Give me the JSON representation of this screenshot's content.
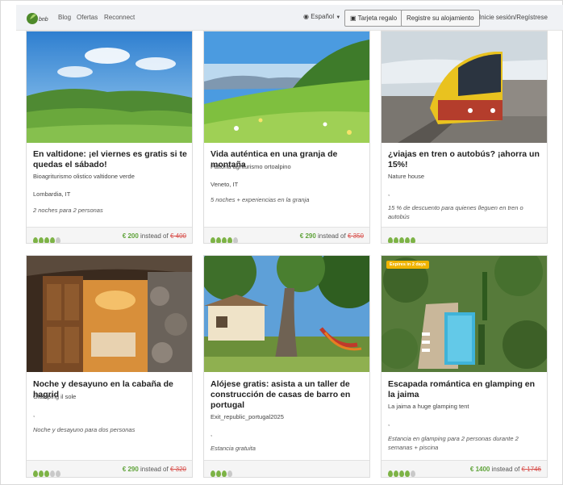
{
  "nav": {
    "logo_text": "bnb",
    "links": [
      "Blog",
      "Ofertas",
      "Reconnect"
    ],
    "language": "Español",
    "gift_card": "Tarjeta regalo",
    "register": "Registre su alojamiento",
    "login": "Inicie sesión/Regístrese"
  },
  "cards": [
    {
      "title": "En valtidone: ¡el viernes es gratis si te quedas el sábado!",
      "host": "Bioagriturismo olistico valtidone verde",
      "location": "Lombardia, IT",
      "offer": "2 noches para 2 personas",
      "rating": 4,
      "price_now": "€ 200",
      "instead_of": "instead of",
      "price_old": "€ 400"
    },
    {
      "title": "Vida auténtica en una granja de montaña",
      "host": "Fattoria agriturismo ortoalpino",
      "location": "Veneto, IT",
      "offer": "5 noches + experiencias en la granja",
      "rating": 4,
      "price_now": "€ 290",
      "instead_of": "instead of",
      "price_old": "€ 350"
    },
    {
      "title": "¿viajas en tren o autobús? ¡ahorra un 15%!",
      "host": "Nature house",
      "location": ",",
      "offer": "15 % de descuento para quienes lleguen en tren o autobús",
      "rating": 5,
      "price_now": "",
      "instead_of": "",
      "price_old": ""
    },
    {
      "title": "Noche y desayuno en la cabaña de hagrid",
      "host": "Glamping il sole",
      "location": ",",
      "offer": "Noche y desayuno para dos personas",
      "rating": 3,
      "price_now": "€ 290",
      "instead_of": "instead of",
      "price_old": "€ 320"
    },
    {
      "title": "Alójese gratis: asista a un taller de construcción de casas de barro en portugal",
      "host": "Exit_republic_portugal2025",
      "location": ",",
      "offer": "Estancia gratuita",
      "rating": 3,
      "price_now": "",
      "instead_of": "",
      "price_old": ""
    },
    {
      "title": "Escapada romántica en glamping en la jaima",
      "host": "La jaima a huge glamping tent",
      "location": ",",
      "offer": "Estancia en glamping para 2 personas durante 2 semanas + piscina",
      "rating": 4,
      "price_now": "€ 1400",
      "instead_of": "instead of",
      "price_old": "€ 1746",
      "badge": "Expires in 2 days"
    }
  ],
  "colors": {
    "accent_green": "#7db346",
    "price_green": "#5fa33a",
    "old_price_red": "#d9534f",
    "badge_yellow": "#f0b400"
  }
}
